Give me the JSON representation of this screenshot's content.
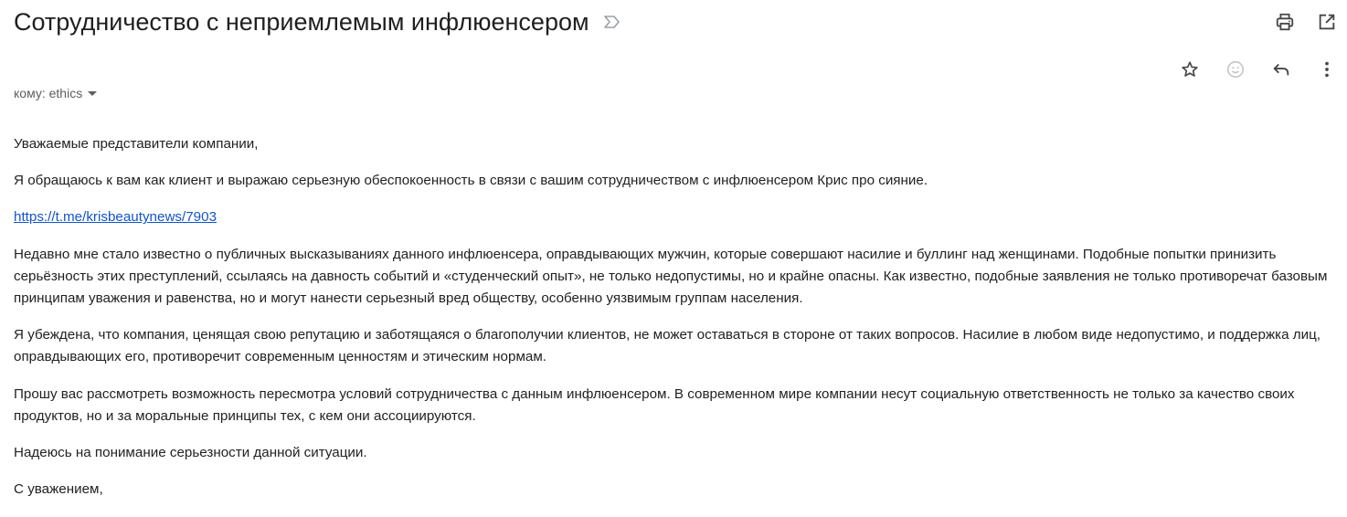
{
  "email": {
    "subject": "Сотрудничество с неприемлемым инфлюенсером",
    "recipient": "кому: ethics"
  },
  "icons": {
    "important": "label-important-icon",
    "print": "print-icon",
    "open_new_window": "open-in-new-icon",
    "star": "star-icon",
    "emoji": "emoji-reaction-icon",
    "reply": "reply-icon",
    "more": "more-vertical-icon"
  },
  "body": {
    "greeting": "Уважаемые представители компании,",
    "p1": "Я обращаюсь к вам как клиент и выражаю серьезную обеспокоенность в связи с вашим сотрудничеством с инфлюенсером Крис про сияние.",
    "link": "https://t.me/krisbeautynews/7903",
    "p2": "Недавно мне стало известно о публичных высказываниях данного инфлюенсера, оправдывающих мужчин, которые совершают насилие и буллинг над женщинами.  Подобные попытки принизить серьёзность этих преступлений, ссылаясь на давность событий и «студенческий опыт», не только недопустимы, но и крайне опасны. Как известно, подобные заявления не только противоречат базовым принципам уважения и равенства, но и могут нанести серьезный вред обществу, особенно уязвимым группам населения.",
    "p3": "Я убеждена, что компания, ценящая свою репутацию и заботящаяся о благополучии клиентов, не может оставаться в стороне от таких вопросов. Насилие в любом виде недопустимо, и поддержка лиц, оправдывающих его, противоречит современным ценностям и этическим нормам.",
    "p4": "Прошу вас рассмотреть возможность пересмотра условий сотрудничества с данным инфлюенсером. В современном мире компании несут социальную ответственность не только за качество своих продуктов, но и за моральные принципы тех, с кем они ассоциируются.",
    "p5": "Надеюсь на понимание серьезности данной ситуации.",
    "closing": "С уважением,"
  },
  "colors": {
    "link": "#1155cc",
    "icon": "#444746",
    "icon_muted": "#c4c7c5"
  }
}
